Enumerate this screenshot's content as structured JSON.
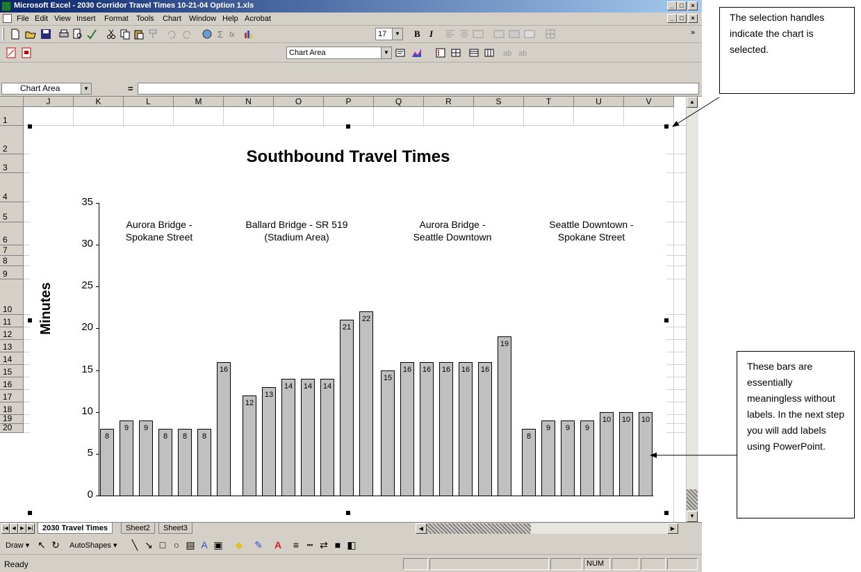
{
  "window": {
    "title": "Microsoft Excel - 2030 Corridor Travel Times 10-21-04 Option 1.xls",
    "buttons": [
      "_",
      "□",
      "×"
    ]
  },
  "menu": [
    "File",
    "Edit",
    "View",
    "Insert",
    "Format",
    "Tools",
    "Chart",
    "Window",
    "Help",
    "Acrobat"
  ],
  "toolbar": {
    "font_size": "17",
    "bold": "B",
    "italic": "I",
    "chart_object": "Chart Area"
  },
  "formula_bar": {
    "name_box": "Chart Area",
    "equals": "="
  },
  "columns": [
    "J",
    "K",
    "L",
    "M",
    "N",
    "O",
    "P",
    "Q",
    "R",
    "S",
    "T",
    "U",
    "V"
  ],
  "rows": [
    "1",
    "2",
    "3",
    "4",
    "5",
    "6",
    "7",
    "8",
    "9",
    "10",
    "11",
    "12",
    "13",
    "14",
    "15",
    "16",
    "17",
    "18",
    "19",
    "20"
  ],
  "chart_data": {
    "type": "bar",
    "title": "Southbound Travel Times",
    "xlabel": "",
    "ylabel": "Minutes",
    "ylim": [
      0,
      35
    ],
    "yticks": [
      "0",
      "5",
      "10",
      "15",
      "20",
      "25",
      "30",
      "35"
    ],
    "groups": [
      {
        "label": "Aurora Bridge -\nSpokane Street",
        "values": [
          8,
          9,
          9,
          8,
          8,
          8,
          16
        ]
      },
      {
        "label": "Ballard Bridge - SR 519\n(Stadium Area)",
        "values": [
          12,
          13,
          14,
          14,
          14,
          21,
          22
        ]
      },
      {
        "label": "Aurora Bridge -\nSeattle Downtown",
        "values": [
          15,
          16,
          16,
          16,
          16,
          16,
          19
        ]
      },
      {
        "label": "Seattle Downtown -\nSpokane Street",
        "values": [
          8,
          9,
          9,
          9,
          10,
          10,
          10
        ]
      }
    ],
    "grid": false,
    "legend": "none",
    "bar_color": "#c0c0c0"
  },
  "sheet_tabs": [
    "2030 Travel Times",
    "Sheet2",
    "Sheet3"
  ],
  "draw_toolbar": {
    "draw": "Draw",
    "autoshapes": "AutoShapes"
  },
  "status": {
    "text": "Ready",
    "num": "NUM"
  },
  "callouts": {
    "selection": "The selection handles indicate the chart is selected.",
    "bars": "These bars are essentially meaningless without labels. In the next step you will add labels using PowerPoint."
  }
}
